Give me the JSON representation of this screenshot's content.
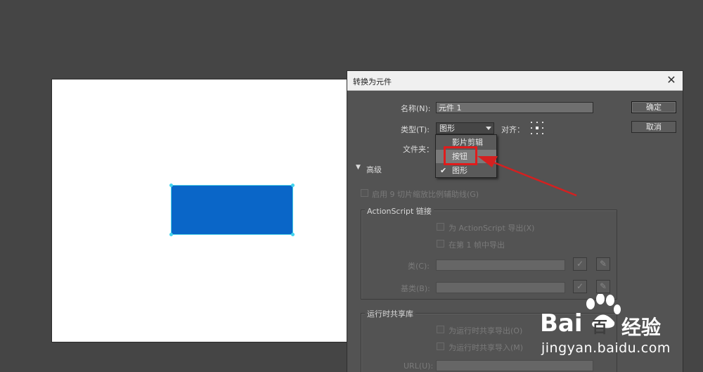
{
  "dialog": {
    "title": "转换为元件",
    "close": "✕",
    "name_label": "名称(N):",
    "name_value": "元件 1",
    "type_label": "类型(T):",
    "type_selected": "图形",
    "align_label": "对齐：",
    "folder_label": "文件夹：",
    "ok_label": "确定",
    "cancel_label": "取消",
    "advanced_label": "高级",
    "nine_slice_label": "启用 9 切片缩放比例辅助线(G)",
    "actionscript_group": "ActionScript 链接",
    "export_as_label": "为 ActionScript 导出(X)",
    "export_frame1_label": "在第 1 帧中导出",
    "class_label": "类(C):",
    "base_class_label": "基类(B):",
    "runtime_group": "运行时共享库",
    "runtime_export_label": "为运行时共享导出(O)",
    "runtime_import_label": "为运行时共享导入(M)",
    "url_label": "URL(U):"
  },
  "dropdown": {
    "items": [
      {
        "label": "影片剪辑",
        "checked": false
      },
      {
        "label": "按钮",
        "checked": false
      },
      {
        "label": "图形",
        "checked": true
      }
    ],
    "check_glyph": "✔"
  },
  "colors": {
    "shape_fill": "#0a66c8",
    "highlight": "#e01c1c",
    "arrow": "#d42020"
  },
  "watermark": {
    "brand": "Bai",
    "brand_suffix": "百",
    "label": "经验",
    "url": "jingyan.baidu.com"
  }
}
